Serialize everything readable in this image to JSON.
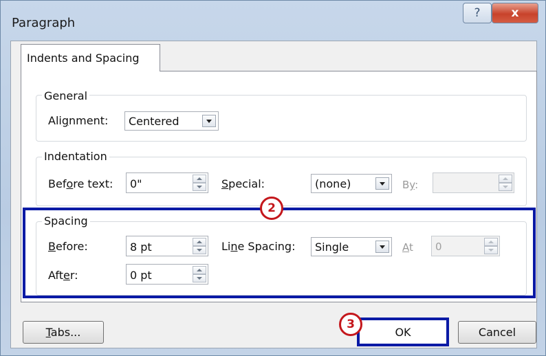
{
  "window": {
    "title": "Paragraph",
    "help_icon": "?",
    "close_icon": "x"
  },
  "tabs": [
    {
      "label": "Indents and Spacing"
    }
  ],
  "general": {
    "title": "General",
    "alignment_label": "Alignment:",
    "alignment_value": "Centered"
  },
  "indentation": {
    "title": "Indentation",
    "before_text_label": "Before text:",
    "before_text_value": "0\"",
    "special_label": "Special:",
    "special_value": "(none)",
    "by_label": "By:",
    "by_value": ""
  },
  "spacing": {
    "title": "Spacing",
    "before_label": "Before:",
    "before_value": "8 pt",
    "after_label": "After:",
    "after_value": "0 pt",
    "line_spacing_label": "Line Spacing:",
    "line_spacing_value": "Single",
    "at_label": "At",
    "at_value": "0"
  },
  "buttons": {
    "tabs": "Tabs...",
    "ok": "OK",
    "cancel": "Cancel"
  },
  "annotations": {
    "marker_2": "2",
    "marker_3": "3",
    "highlight_color": "#0a1aa5",
    "marker_color": "#c4171c"
  }
}
